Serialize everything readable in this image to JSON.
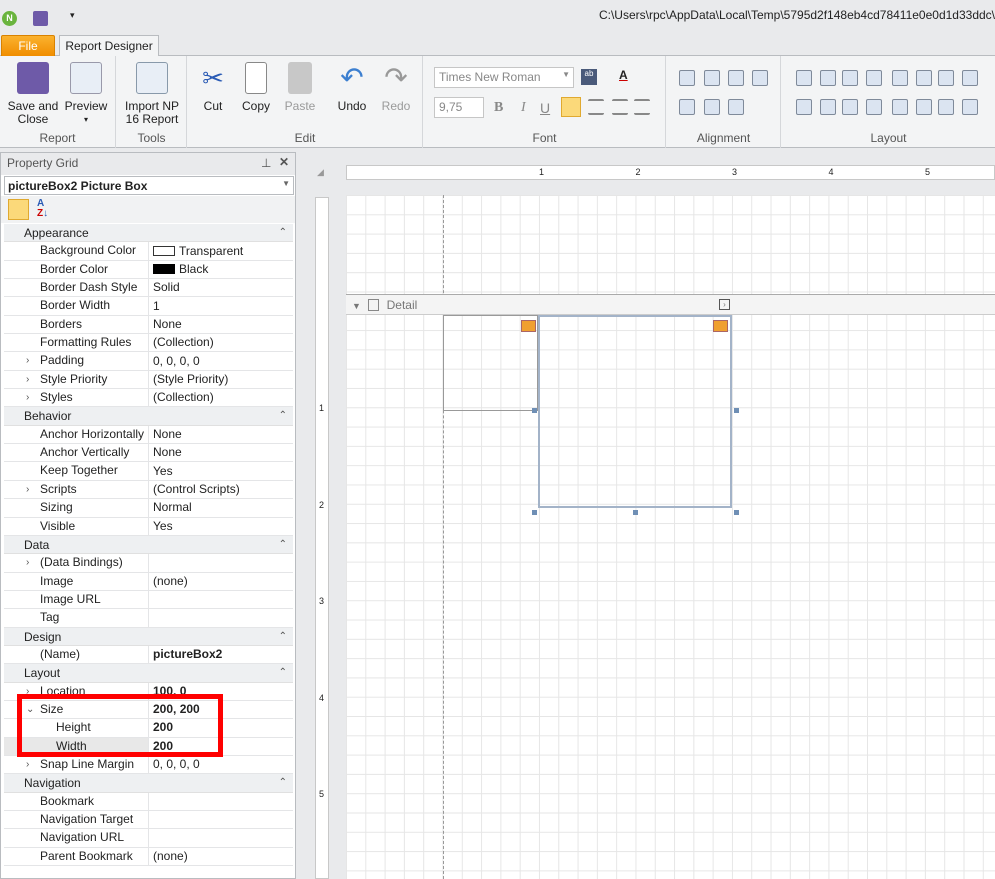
{
  "titlebar": {
    "path": "C:\\Users\\rpc\\AppData\\Local\\Temp\\5795d2f148eb4cd78411e0e0d1d33ddc\\"
  },
  "tabs": [
    {
      "label": "File"
    },
    {
      "label": "Report Designer"
    }
  ],
  "ribbon": {
    "report": {
      "label": "Report",
      "save": "Save and Close",
      "preview": "Preview"
    },
    "tools": {
      "label": "Tools",
      "import": "Import NP 16 Report"
    },
    "edit": {
      "label": "Edit",
      "cut": "Cut",
      "copy": "Copy",
      "paste": "Paste",
      "undo": "Undo",
      "redo": "Redo"
    },
    "font": {
      "label": "Font",
      "family": "Times New Roman",
      "size": "9,75",
      "bold": "B",
      "italic": "I",
      "underline": "U"
    },
    "alignment": {
      "label": "Alignment"
    },
    "layout": {
      "label": "Layout"
    }
  },
  "property_grid": {
    "title": "Property Grid",
    "selected": "pictureBox2  Picture Box",
    "categories": [
      {
        "name": "Appearance",
        "rows": [
          [
            "Background Color",
            "Transparent",
            "swatch-white"
          ],
          [
            "Border Color",
            "Black",
            "swatch-black"
          ],
          [
            "Border Dash Style",
            "Solid"
          ],
          [
            "Border Width",
            "1"
          ],
          [
            "Borders",
            "None"
          ],
          [
            "Formatting Rules",
            "(Collection)"
          ],
          [
            "Padding",
            "0, 0, 0, 0",
            "exp"
          ],
          [
            "Style Priority",
            "(Style Priority)",
            "exp"
          ],
          [
            "Styles",
            "(Collection)",
            "exp"
          ]
        ]
      },
      {
        "name": "Behavior",
        "rows": [
          [
            "Anchor Horizontally",
            "None"
          ],
          [
            "Anchor Vertically",
            "None"
          ],
          [
            "Keep Together",
            "Yes"
          ],
          [
            "Scripts",
            "(Control Scripts)",
            "exp"
          ],
          [
            "Sizing",
            "Normal"
          ],
          [
            "Visible",
            "Yes"
          ]
        ]
      },
      {
        "name": "Data",
        "rows": [
          [
            "(Data Bindings)",
            "",
            "exp"
          ],
          [
            "Image",
            "(none)"
          ],
          [
            "Image URL",
            ""
          ],
          [
            "Tag",
            ""
          ]
        ]
      },
      {
        "name": "Design",
        "rows": [
          [
            "(Name)",
            "pictureBox2",
            "bold"
          ]
        ]
      },
      {
        "name": "Layout",
        "rows": [
          [
            "Location",
            "100, 0",
            "exp bold"
          ],
          [
            "Size",
            "200, 200",
            "open bold"
          ],
          [
            "Height",
            "200",
            "sub bold"
          ],
          [
            "Width",
            "200",
            "sub bold sel"
          ],
          [
            "Snap Line Margin",
            "0, 0, 0, 0",
            "exp"
          ]
        ]
      },
      {
        "name": "Navigation",
        "rows": [
          [
            "Bookmark",
            ""
          ],
          [
            "Navigation Target",
            ""
          ],
          [
            "Navigation URL",
            ""
          ],
          [
            "Parent Bookmark",
            "(none)"
          ]
        ]
      }
    ]
  },
  "designer": {
    "band": "Detail",
    "hruler": [
      "1",
      "2",
      "3",
      "4",
      "5"
    ],
    "vruler": [
      "1",
      "2",
      "3",
      "4",
      "5"
    ]
  }
}
